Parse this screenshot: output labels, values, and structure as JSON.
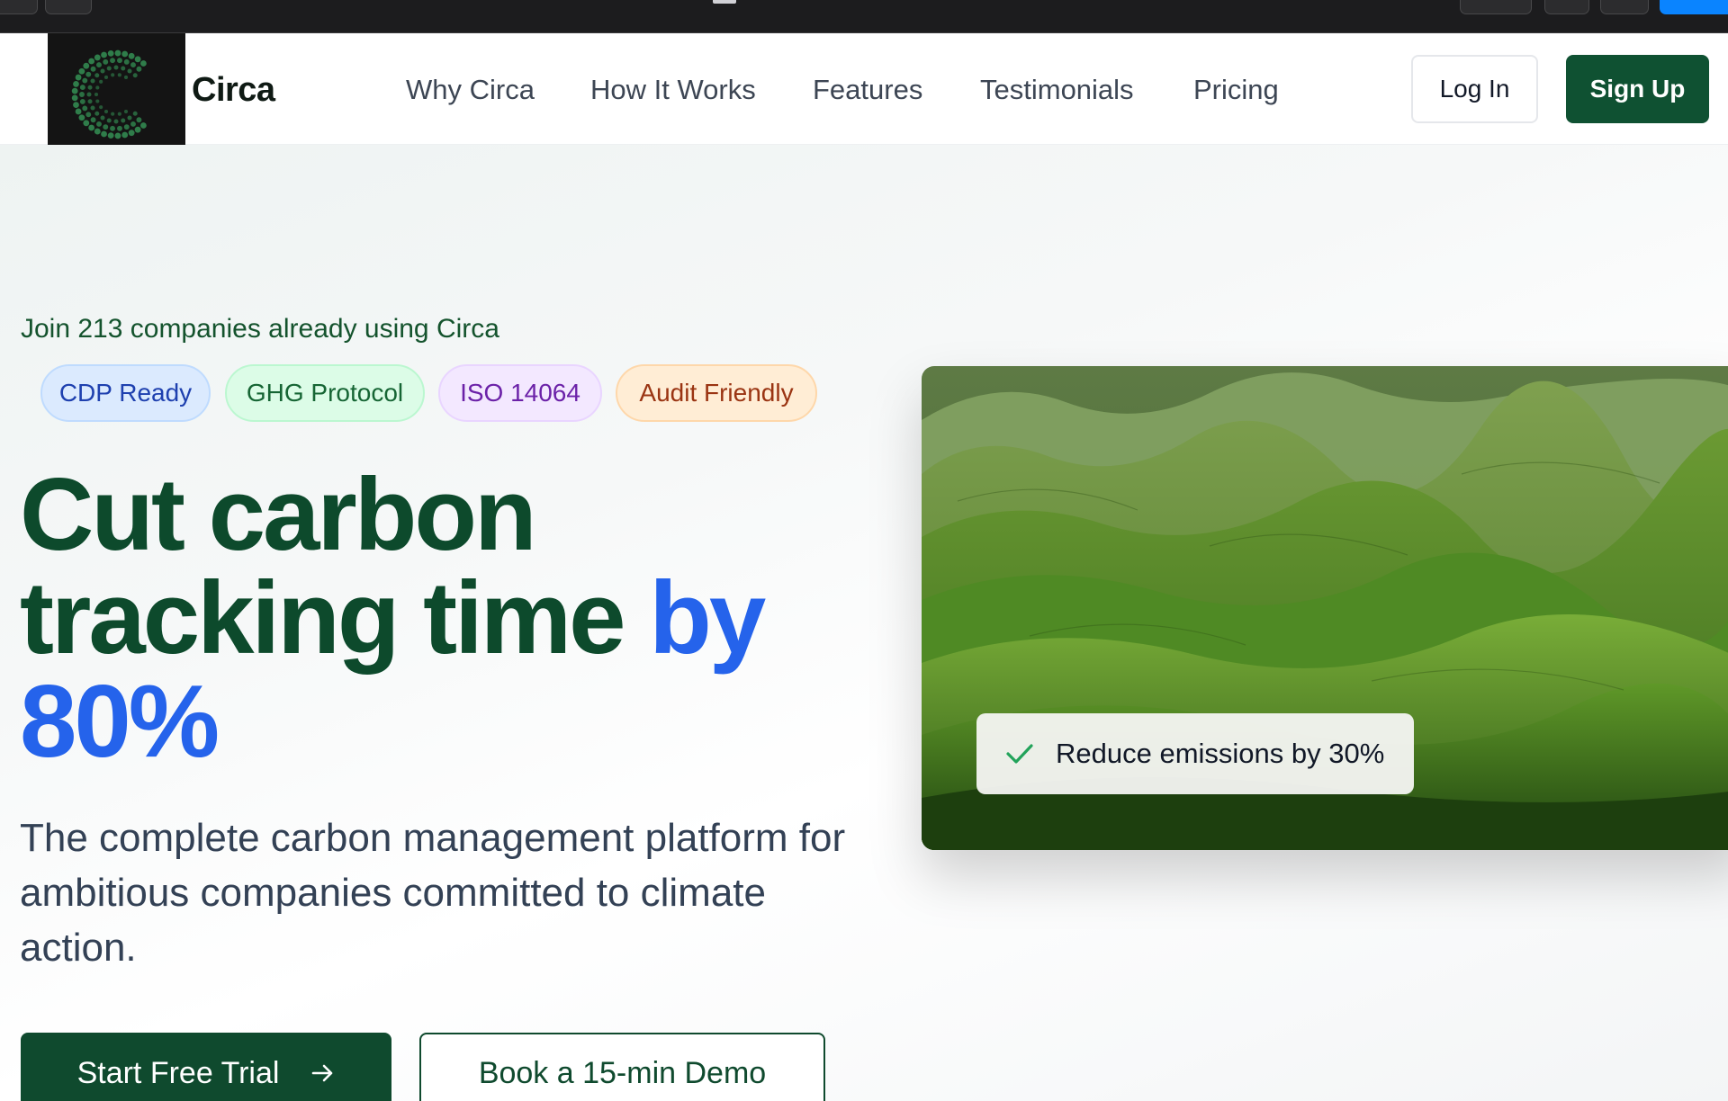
{
  "brand": {
    "name": "Circa",
    "logo_icon": "dotted-circle-c-logo",
    "logo_color": "#2f7d4a"
  },
  "nav": {
    "links": [
      "Why Circa",
      "How It Works",
      "Features",
      "Testimonials",
      "Pricing"
    ],
    "login_label": "Log In",
    "signup_label": "Sign Up"
  },
  "hero": {
    "social_proof": "Join 213 companies already using Circa",
    "badges": [
      "CDP Ready",
      "GHG Protocol",
      "ISO 14064",
      "Audit Friendly"
    ],
    "headline_line1": "Cut carbon",
    "headline_line2": "tracking time",
    "headline_highlight_a": "by",
    "headline_highlight_b": "80%",
    "subtitle": "The complete carbon management platform for ambitious companies committed to climate action.",
    "cta_primary": "Start Free Trial",
    "cta_primary_icon": "arrow-right-icon",
    "cta_secondary": "Book a 15-min Demo",
    "image_subject": "green rolling hills landscape",
    "stat_icon": "checkmark-icon",
    "stat_label": "Reduce emissions by 30%"
  },
  "colors": {
    "primary_green": "#0f4a2e",
    "headline_green": "#0d4a2c",
    "accent_blue": "#2563eb"
  }
}
